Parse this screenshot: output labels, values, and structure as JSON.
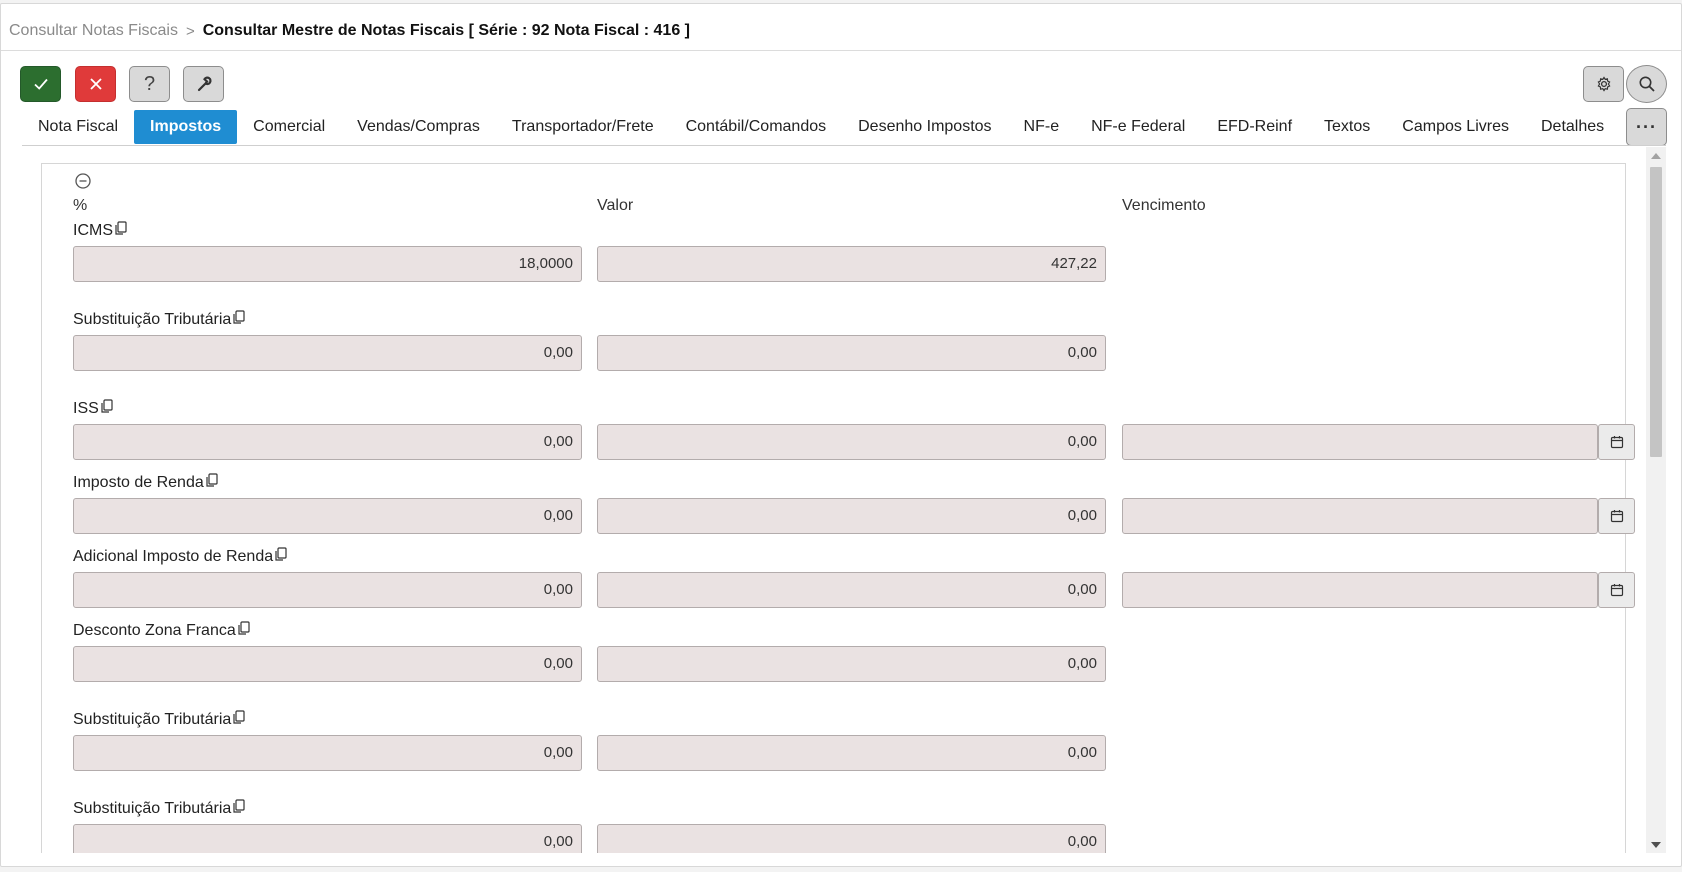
{
  "breadcrumb": {
    "parent": "Consultar Notas Fiscais",
    "separator": ">",
    "current": "Consultar Mestre de Notas Fiscais [ Série : 92 Nota Fiscal : 416 ]"
  },
  "toolbar": {
    "help_label": "?",
    "more_label": "···"
  },
  "tabs": [
    {
      "label": "Nota Fiscal"
    },
    {
      "label": "Impostos",
      "active": true
    },
    {
      "label": "Comercial"
    },
    {
      "label": "Vendas/Compras"
    },
    {
      "label": "Transportador/Frete"
    },
    {
      "label": "Contábil/Comandos"
    },
    {
      "label": "Desenho Impostos"
    },
    {
      "label": "NF-e"
    },
    {
      "label": "NF-e Federal"
    },
    {
      "label": "EFD-Reinf"
    },
    {
      "label": "Textos"
    },
    {
      "label": "Campos Livres"
    },
    {
      "label": "Detalhes"
    }
  ],
  "columns": {
    "percent": "%",
    "value": "Valor",
    "due": "Vencimento"
  },
  "rows": [
    {
      "label": "ICMS",
      "percent": "18,0000",
      "value": "427,22"
    },
    {
      "label": "Substituição Tributária",
      "percent": "0,00",
      "value": "0,00"
    },
    {
      "label": "ISS",
      "percent": "0,00",
      "value": "0,00",
      "due": ""
    },
    {
      "label": "Imposto de Renda",
      "percent": "0,00",
      "value": "0,00",
      "due": ""
    },
    {
      "label": "Adicional Imposto de Renda",
      "percent": "0,00",
      "value": "0,00",
      "due": ""
    },
    {
      "label": "Desconto Zona Franca",
      "percent": "0,00",
      "value": "0,00"
    },
    {
      "label": "Substituição Tributária",
      "percent": "0,00",
      "value": "0,00"
    },
    {
      "label": "Substituição Tributária",
      "percent": "0,00",
      "value": "0,00"
    }
  ],
  "colors": {
    "confirm": "#2c6e2f",
    "cancel": "#e03a3a",
    "active_tab": "#1f8dd2",
    "field_bg": "#eae2e2"
  },
  "icons": [
    "check-icon",
    "close-icon",
    "wrench-icon",
    "gear-icon",
    "search-icon",
    "collapse-icon",
    "copy-icon",
    "calendar-icon"
  ]
}
